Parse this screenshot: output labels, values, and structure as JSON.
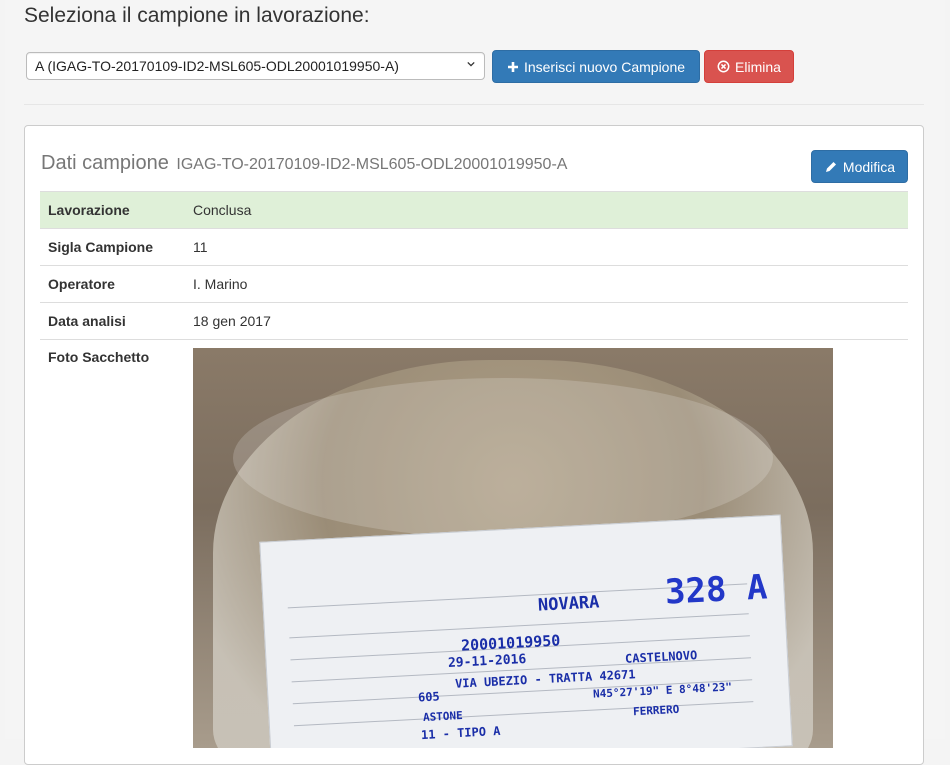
{
  "header": {
    "title": "Seleziona il campione in lavorazione:"
  },
  "sample_select": {
    "selected_value": "A (IGAG-TO-20170109-ID2-MSL605-ODL20001019950-A)"
  },
  "actions": {
    "new_sample_label": "Inserisci nuovo Campione",
    "delete_label": "Elimina"
  },
  "panel": {
    "title": "Dati campione",
    "sample_id": "IGAG-TO-20170109-ID2-MSL605-ODL20001019950-A",
    "edit_label": "Modifica"
  },
  "details": {
    "rows": [
      {
        "key": "Lavorazione",
        "value": "Conclusa",
        "status": "success"
      },
      {
        "key": "Sigla Campione",
        "value": "11"
      },
      {
        "key": "Operatore",
        "value": "I. Marino"
      },
      {
        "key": "Data analisi",
        "value": "18 gen 2017"
      }
    ],
    "photo_label": "Foto Sacchetto"
  },
  "photo": {
    "handwriting": {
      "co": "NOVARA",
      "code": "328 A",
      "cantiere": "20001019950",
      "data": "29-11-2016",
      "comune": "CASTELNOVO",
      "indirizzo": "VIA UBEZIO - TRATTA 42671",
      "riferimento": "605",
      "gps": "N45°27'19\" E 8°48'23\"",
      "ditta": "ASTONE",
      "tecnico": "FERRERO",
      "campione": "11 - TIPO A"
    }
  },
  "colors": {
    "primary": "#337ab7",
    "danger": "#d9534f",
    "success_row": "#dff0d8"
  }
}
